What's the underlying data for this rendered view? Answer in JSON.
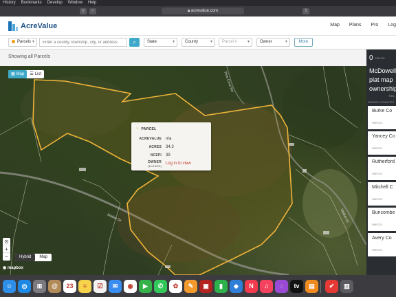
{
  "menubar": {
    "items": [
      "History",
      "Bookmarks",
      "Develop",
      "Window",
      "Help"
    ]
  },
  "browser": {
    "url": "acrevalue.com"
  },
  "header": {
    "logo_text": "AcreValue",
    "nav": [
      "Map",
      "Plans",
      "Pro",
      "Log"
    ]
  },
  "filters": {
    "layer_label": "Parcels",
    "search_placeholder": "Enter a county, township, city, or address",
    "state_label": "State",
    "county_label": "County",
    "parcel_label": "Parcel #",
    "owner_label": "Owner",
    "more_label": "More"
  },
  "status": {
    "text": "Showing all Parcels"
  },
  "map": {
    "view_map": "Map",
    "view_list": "List",
    "road_labels": [
      "Pine Cove Rd",
      "Walker Dr",
      "Walker Dr"
    ],
    "base_hybrid": "Hybrid",
    "base_map": "Map",
    "attribution": "mapbox"
  },
  "popup": {
    "title": "PARCEL",
    "rows": [
      {
        "key": "ACREVALUE",
        "value": "n/a",
        "link": false
      },
      {
        "key": "ACRES",
        "value": "34.3",
        "link": false
      },
      {
        "key": "NCEPI",
        "value": "39",
        "link": false
      },
      {
        "key": "OWNER",
        "sub": "(11/13/22)",
        "value": "Log in to view",
        "link": true
      }
    ]
  },
  "panel": {
    "count": "0",
    "fields_label": "FIELDS",
    "title_lines": [
      "McDowell",
      "plat map",
      "ownership"
    ],
    "field_hint": "FIEL",
    "nearby_label": "NEARBY COUNTIES",
    "counties": [
      "Burke Co",
      "Yancey Co",
      "Rutherford",
      "Mitchell C",
      "Buncombe",
      "Avery Co"
    ],
    "county_sub": "PARCEL"
  },
  "dock": {
    "icons": [
      {
        "name": "finder-icon",
        "color": "#2f8fe8",
        "glyph": "☺"
      },
      {
        "name": "safari-icon",
        "color": "#1e88e5",
        "glyph": "◎"
      },
      {
        "name": "launchpad-icon",
        "color": "#7a7a80",
        "glyph": "⊞"
      },
      {
        "name": "contacts-icon",
        "color": "#b38b59",
        "glyph": "@"
      },
      {
        "name": "calendar-icon",
        "color": "#ffffff",
        "glyph": "23"
      },
      {
        "name": "notes-icon",
        "color": "#f6d34b",
        "glyph": "≡"
      },
      {
        "name": "reminders-icon",
        "color": "#f2f2f2",
        "glyph": "☑"
      },
      {
        "name": "mail-icon",
        "color": "#3a8df0",
        "glyph": "✉"
      },
      {
        "name": "chrome-icon",
        "color": "#ffffff",
        "glyph": "◉"
      },
      {
        "name": "facetime-icon",
        "color": "#36b24a",
        "glyph": "▶"
      },
      {
        "name": "messages-icon",
        "color": "#32c759",
        "glyph": "✆"
      },
      {
        "name": "photos-icon",
        "color": "#ffffff",
        "glyph": "✿"
      },
      {
        "name": "pages-icon",
        "color": "#f39a2e",
        "glyph": "✎"
      },
      {
        "name": "photobooth-icon",
        "color": "#b3231f",
        "glyph": "▣"
      },
      {
        "name": "numbers-icon",
        "color": "#2cb14b",
        "glyph": "▮"
      },
      {
        "name": "keynote-icon",
        "color": "#2f7fd8",
        "glyph": "◆"
      },
      {
        "name": "news-icon",
        "color": "#f23b4e",
        "glyph": "N"
      },
      {
        "name": "music-icon",
        "color": "#f5425e",
        "glyph": "♫"
      },
      {
        "name": "podcasts-icon",
        "color": "#9a4bd6",
        "glyph": "◌"
      },
      {
        "name": "appletv-icon",
        "color": "#111111",
        "glyph": "tv"
      },
      {
        "name": "books-icon",
        "color": "#f08a1c",
        "glyph": "▤"
      },
      {
        "name": "divider",
        "color": "#3c3c40",
        "glyph": ""
      },
      {
        "name": "tasks-icon",
        "color": "#e53935",
        "glyph": "✔"
      },
      {
        "name": "trash-icon",
        "color": "#5a5a60",
        "glyph": "▥"
      }
    ]
  }
}
